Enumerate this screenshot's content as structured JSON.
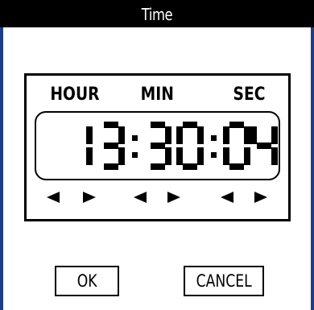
{
  "window": {
    "title": "Time"
  },
  "clock": {
    "labels": {
      "hour": "HOUR",
      "min": "MIN",
      "sec": "SEC"
    },
    "hour": "13",
    "minute": "30",
    "second": "04",
    "separator": ":"
  },
  "controls": {
    "decrement_icon": "triangle-left-icon",
    "increment_icon": "triangle-right-icon"
  },
  "buttons": {
    "ok_label": "OK",
    "cancel_label": "CANCEL"
  },
  "colors": {
    "titlebar": "#000000",
    "title_text": "#ffffff",
    "window_edge": "#1c3e8a",
    "lcd_segment": "#000000"
  }
}
